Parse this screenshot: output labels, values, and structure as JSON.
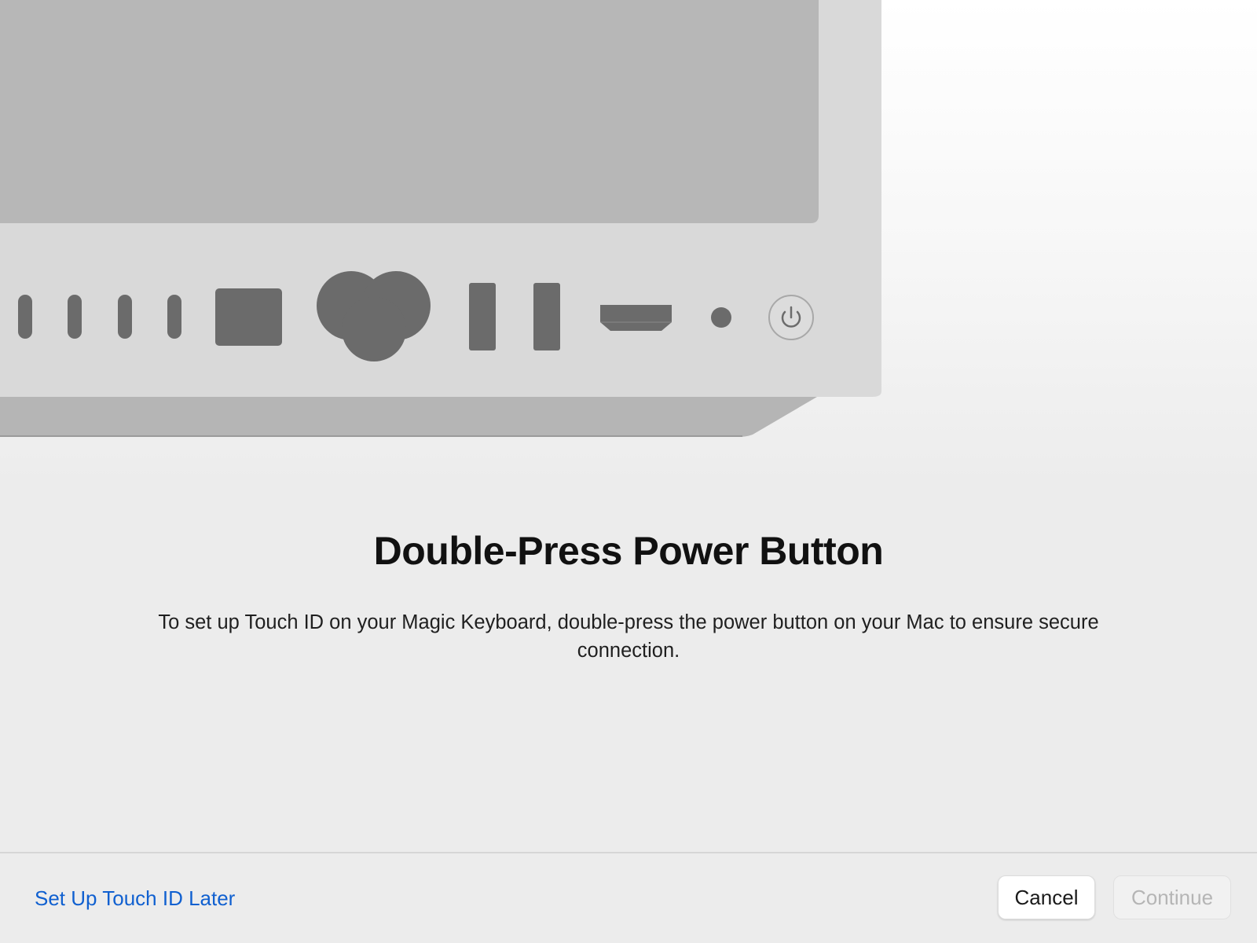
{
  "illustration": {
    "device": "mac-studio-back-panel",
    "ports": [
      "usb-c-port",
      "usb-c-port",
      "usb-c-port",
      "usb-c-port",
      "ethernet-port",
      "power-inlet",
      "usb-a-port",
      "usb-a-port",
      "hdmi-port",
      "headphone-jack",
      "power-button-icon"
    ],
    "colors": {
      "body": "#d9d9d9",
      "top_panel": "#b7b7b7",
      "base": "#b5b5b5",
      "port": "#6b6b6b"
    }
  },
  "dialog": {
    "title": "Double-Press Power Button",
    "description": "To set up Touch ID on your Magic Keyboard, double-press the power button on your Mac to ensure secure connection."
  },
  "footer": {
    "later_link": "Set Up Touch ID Later",
    "cancel_label": "Cancel",
    "continue_label": "Continue",
    "link_color": "#1060d0"
  }
}
